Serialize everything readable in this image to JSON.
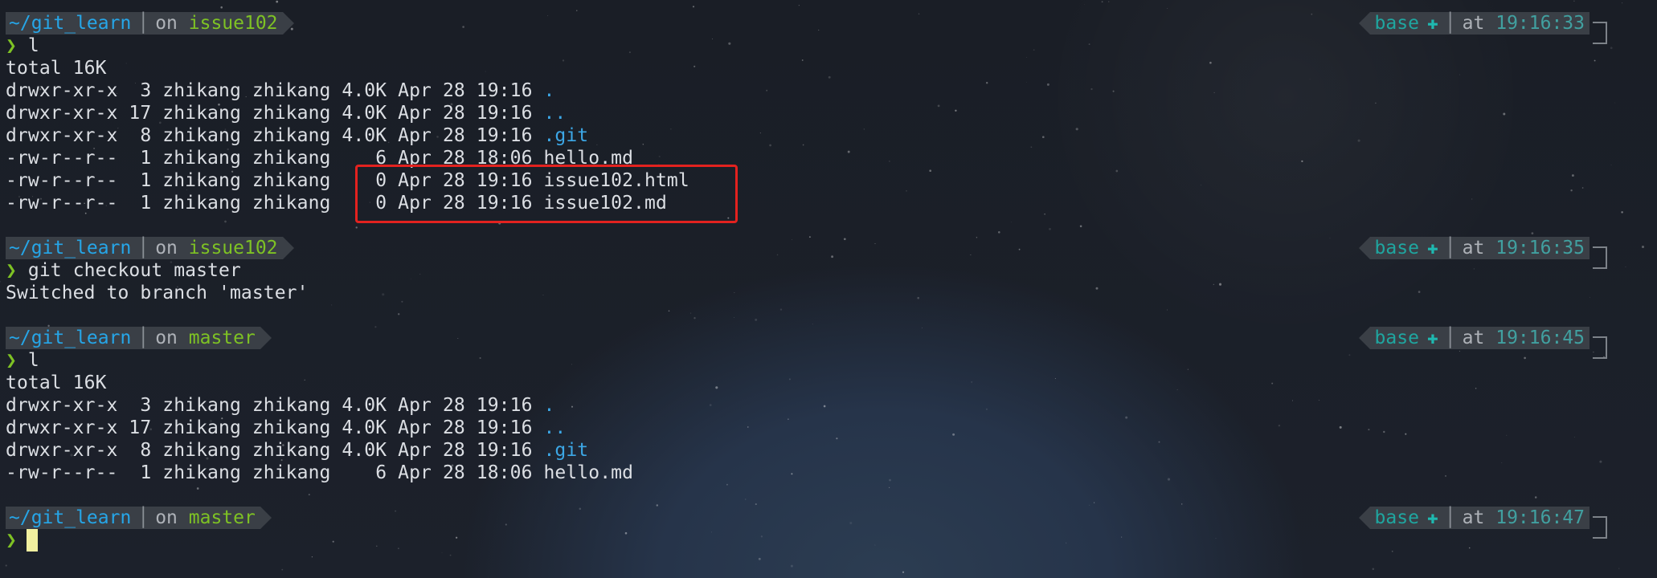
{
  "colors": {
    "background": "#1b2029",
    "segment_bg": "#3a3f46",
    "dir": "#26a6e8",
    "branch": "#7ec224",
    "env": "#1fa6a0",
    "time": "#41a0a0",
    "highlight": "#e3221f",
    "cursor": "#f1f0a0"
  },
  "prompts": [
    {
      "dir": "~/git_learn",
      "on": "on",
      "branch": "issue102",
      "env": "base",
      "at": "at",
      "time": "19:16:33",
      "chevron": "❯",
      "command": "l"
    },
    {
      "dir": "~/git_learn",
      "on": "on",
      "branch": "issue102",
      "env": "base",
      "at": "at",
      "time": "19:16:35",
      "chevron": "❯",
      "command": "git checkout master"
    },
    {
      "dir": "~/git_learn",
      "on": "on",
      "branch": "master",
      "env": "base",
      "at": "at",
      "time": "19:16:45",
      "chevron": "❯",
      "command": "l"
    },
    {
      "dir": "~/git_learn",
      "on": "on",
      "branch": "master",
      "env": "base",
      "at": "at",
      "time": "19:16:47",
      "chevron": "❯",
      "command": ""
    }
  ],
  "listing1": {
    "total": "total 16K",
    "rows": [
      {
        "meta": "drwxr-xr-x  3 zhikang zhikang 4.0K Apr 28 19:16 ",
        "name": ".",
        "is_dir": true
      },
      {
        "meta": "drwxr-xr-x 17 zhikang zhikang 4.0K Apr 28 19:16 ",
        "name": "..",
        "is_dir": true
      },
      {
        "meta": "drwxr-xr-x  8 zhikang zhikang 4.0K Apr 28 19:16 ",
        "name": ".git",
        "is_dir": true
      },
      {
        "meta": "-rw-r--r--  1 zhikang zhikang    6 Apr 28 18:06 ",
        "name": "hello.md",
        "is_dir": false
      },
      {
        "meta": "-rw-r--r--  1 zhikang zhikang    0 Apr 28 19:16 ",
        "name": "issue102.html",
        "is_dir": false
      },
      {
        "meta": "-rw-r--r--  1 zhikang zhikang    0 Apr 28 19:16 ",
        "name": "issue102.md",
        "is_dir": false
      }
    ]
  },
  "checkout_output": "Switched to branch 'master'",
  "listing2": {
    "total": "total 16K",
    "rows": [
      {
        "meta": "drwxr-xr-x  3 zhikang zhikang 4.0K Apr 28 19:16 ",
        "name": ".",
        "is_dir": true
      },
      {
        "meta": "drwxr-xr-x 17 zhikang zhikang 4.0K Apr 28 19:16 ",
        "name": "..",
        "is_dir": true
      },
      {
        "meta": "drwxr-xr-x  8 zhikang zhikang 4.0K Apr 28 19:16 ",
        "name": ".git",
        "is_dir": true
      },
      {
        "meta": "-rw-r--r--  1 zhikang zhikang    6 Apr 28 18:06 ",
        "name": "hello.md",
        "is_dir": false
      }
    ]
  }
}
